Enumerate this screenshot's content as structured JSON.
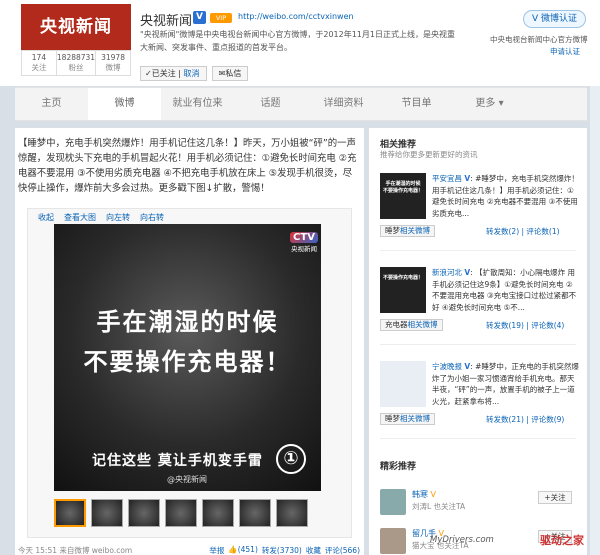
{
  "profile": {
    "logo_text": "央视新闻",
    "name": "央视新闻",
    "verified": "V",
    "level": "VIP",
    "url": "http://weibo.com/cctvxinwen",
    "description": "\"央视新闻\"微博是中央电视台新闻中心官方微博，于2012年11月1日正式上线，是央视重大新闻、突发事件、重点报道的首发平台。",
    "stats": [
      {
        "num": "174",
        "label": "关注"
      },
      {
        "num": "18288731",
        "label": "粉丝"
      },
      {
        "num": "31978",
        "label": "微博"
      }
    ],
    "followed_label": "已关注",
    "cancel_label": "取消",
    "message_label": "私信",
    "auth_button": "微博认证",
    "auth_desc": "中央电视台新闻中心官方微博",
    "auth_apply": "申请认证"
  },
  "nav": {
    "items": [
      "主页",
      "微博",
      "就业有位来",
      "话题",
      "详细资料",
      "节目单",
      "更多 ▾"
    ]
  },
  "post": {
    "text": "【睡梦中，充电手机突然爆炸！用手机记住这几条！】昨天，万小姐被“砰”的一声惊醒，发现枕头下充电的手机冒起火花！用手机必须记住：①避免长时间充电 ②充电器不要混用 ③不使用劣质充电器 ④不把充电手机放在床上 ⑤发现手机很烫，尽快停止操作，爆炸前大多会过热。更多戳下图↓扩散，警惕！",
    "tools": [
      "收起",
      "查看大图",
      "向左转",
      "向右转"
    ],
    "image": {
      "line1": "手在潮湿的时候",
      "line2": "不要操作充电器！",
      "line3": "记住这些 莫让手机变手雷",
      "num": "①",
      "watermark": "@央视新闻",
      "badge_big": "CTV",
      "badge_small": "央视新闻"
    },
    "foot_left": "今天 15:51 来自微博 weibo.com",
    "foot_report": "举报",
    "foot_like": "(451)",
    "foot_repost": "转发(3730)",
    "foot_fav": "收藏",
    "foot_comment": "评论(566)"
  },
  "side": {
    "rec_title": "相关推荐",
    "rec_sub": "推荐给你更多更新更好的资讯",
    "recs": [
      {
        "thumb": "手在潮湿的时候\n不要操作充电器！",
        "user": "平安宜昌",
        "text": "#睡梦中，充电手机突然爆炸！用手机记住这几条！】用手机必须记住：①避免长时间充电 ②充电器不要混用 ③不使用劣质充电...",
        "tag_user": "睡梦",
        "tag_rest": "相关微博",
        "reposts": "转发数(2)",
        "comments": "评论数(1)"
      },
      {
        "thumb": "不要操作充电器！",
        "user": "新浪河北",
        "text": "【扩散周知：小心隔电爆炸 用手机必须记住这9条】①避免长时间充电 ②不要混用充电器 ③充电宝接口过松过紧都不好 ④避免长时间充电 ⑤不...",
        "tag_user": "充电器",
        "tag_rest": "相关微博",
        "reposts": "转发数(19)",
        "comments": "评论数(4)"
      },
      {
        "thumb": "",
        "user": "宁波晚报",
        "text": "#睡梦中，正充电的手机突然爆炸了为小姐一家习惯通宵给手机充电。那天半夜，“砰”的一声，放置手机的被子上一道火光，赶紧拿布将...",
        "tag_user": "睡梦",
        "tag_rest": "相关微博",
        "reposts": "转发数(21)",
        "comments": "评论数(9)"
      }
    ],
    "fans_title": "精彩推荐",
    "fans": [
      {
        "name": "韩寒",
        "sub": "刘涛L 也关注TA",
        "btn": "+关注"
      },
      {
        "name": "留几手",
        "sub": "猫大宝 也关注TA",
        "btn": "+关注"
      }
    ]
  },
  "watermark": {
    "site": "MyDrivers.com",
    "brand": "驱动之家"
  },
  "colors": {
    "link": "#0a63b5",
    "logo_red": "#b22a1b"
  }
}
